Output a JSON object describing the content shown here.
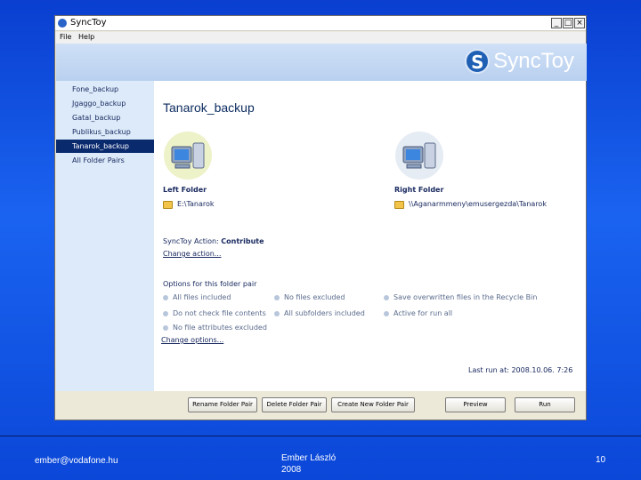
{
  "window": {
    "title": "SyncToy",
    "minimize": "_",
    "maximize": "□",
    "close": "×",
    "menu": [
      "File",
      "Help"
    ]
  },
  "logo": {
    "mark": "S",
    "text": "SyncToy"
  },
  "sidebar": {
    "items": [
      {
        "label": "Fone_backup"
      },
      {
        "label": "Jgaggo_backup"
      },
      {
        "label": "Gatal_backup"
      },
      {
        "label": "Publikus_backup"
      },
      {
        "label": "Tanarok_backup",
        "selected": true
      },
      {
        "label": "All Folder Pairs"
      }
    ]
  },
  "content": {
    "pair_name": "Tanarok_backup",
    "left_folder": {
      "heading": "Left Folder",
      "path": "E:\\Tanarok"
    },
    "right_folder": {
      "heading": "Right Folder",
      "path": "\\\\Aganarmmeny\\emusergezda\\Tanarok"
    },
    "action_label": "SyncToy Action:",
    "action_value": "Contribute",
    "change_action": "Change action...",
    "options_heading": "Options for this folder pair",
    "options": [
      "All files included",
      "No files excluded",
      "Save overwritten files in the Recycle Bin",
      "Do not check file contents",
      "All subfolders included",
      "Active for run all",
      "No file attributes excluded"
    ],
    "change_options": "Change options...",
    "last_run": "Last run at: 2008.10.06. 7:26"
  },
  "buttons": {
    "rename": "Rename Folder Pair",
    "delete": "Delete Folder Pair",
    "create": "Create New Folder Pair",
    "preview": "Preview",
    "run": "Run"
  },
  "footer": {
    "email": "ember@vodafone.hu",
    "author": "Ember László",
    "year": "2008",
    "page": "10"
  },
  "colors": {
    "slide_background": "#1a63f0",
    "sidebar_selected": "#0a2a6e",
    "sidebar_background": "#dceaf9",
    "banner": "#c4d8f3"
  }
}
